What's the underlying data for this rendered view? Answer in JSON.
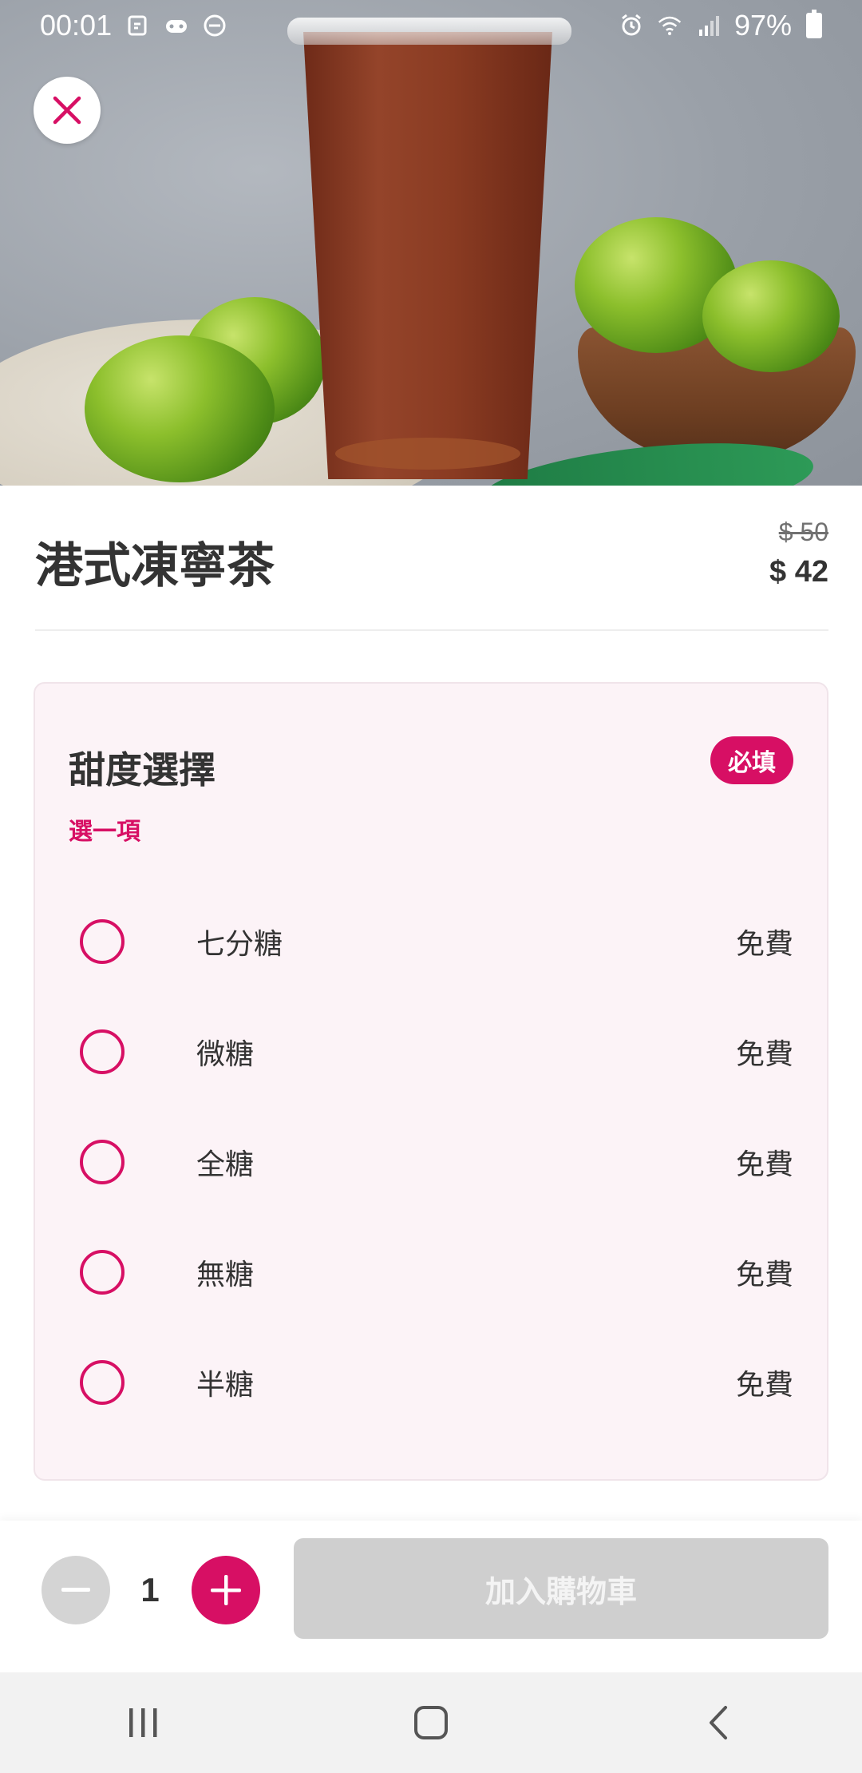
{
  "status_bar": {
    "time": "00:01",
    "battery": "97%",
    "left_icons": [
      "notification-icon",
      "game-icon",
      "do-not-disturb-icon"
    ],
    "right_icons": [
      "alarm-icon",
      "wifi-icon",
      "signal-icon",
      "battery-icon"
    ]
  },
  "product": {
    "title": "港式凍寧茶",
    "price_original": "$ 50",
    "price_current": "$ 42"
  },
  "option_group": {
    "heading": "甜度選擇",
    "required_label": "必填",
    "subtitle": "選一項",
    "options": [
      {
        "label": "七分糖",
        "price": "免費"
      },
      {
        "label": "微糖",
        "price": "免費"
      },
      {
        "label": "全糖",
        "price": "免費"
      },
      {
        "label": "無糖",
        "price": "免費"
      },
      {
        "label": "半糖",
        "price": "免費"
      }
    ]
  },
  "cart": {
    "quantity": "1",
    "add_button_label": "加入購物車"
  },
  "colors": {
    "accent": "#d70f64",
    "card_background": "#fcf3f7",
    "disabled": "#cfcfcf"
  }
}
